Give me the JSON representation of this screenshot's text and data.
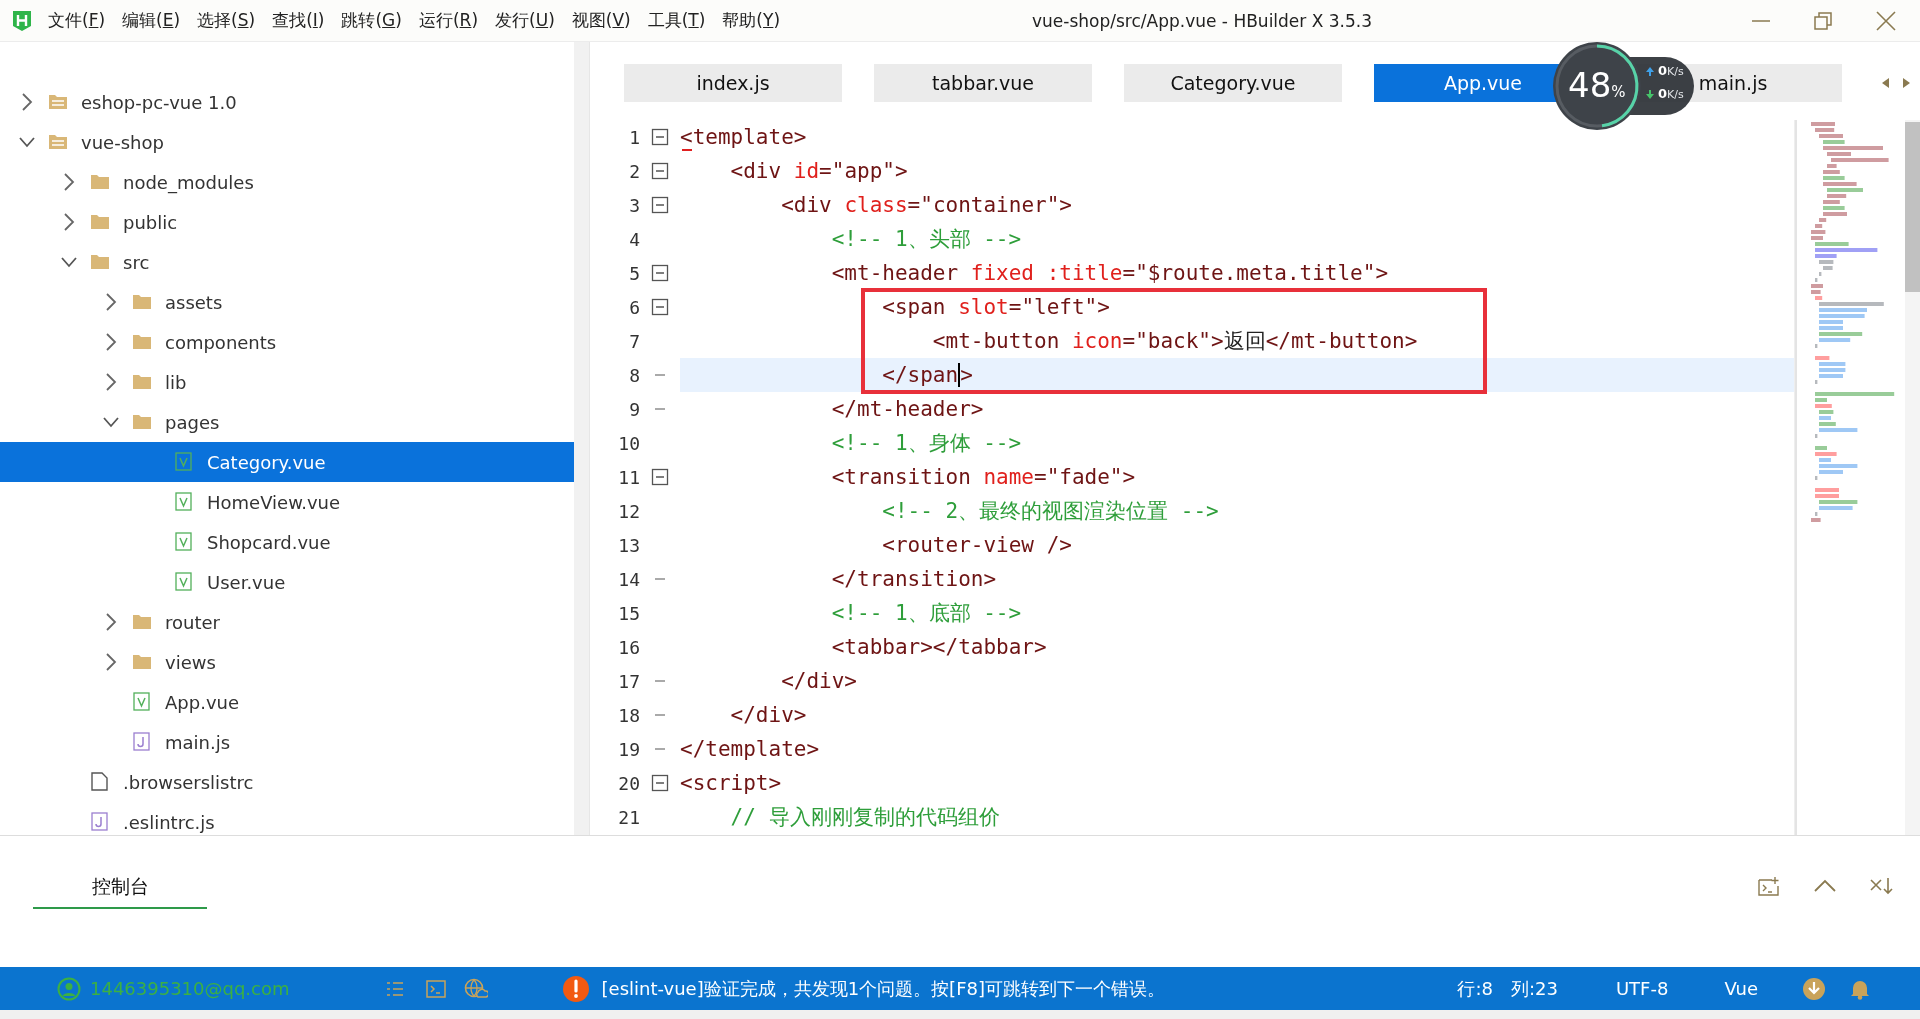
{
  "window": {
    "title": "vue-shop/src/App.vue - HBuilder X 3.5.3"
  },
  "menu": [
    "文件(F)",
    "编辑(E)",
    "选择(S)",
    "查找(I)",
    "跳转(G)",
    "运行(R)",
    "发行(U)",
    "视图(V)",
    "工具(T)",
    "帮助(Y)"
  ],
  "sidebar": {
    "tree": [
      {
        "label": "eshop-pc-vue 1.0",
        "kind": "project",
        "expanded": false,
        "selected": false
      },
      {
        "label": "vue-shop",
        "kind": "project",
        "expanded": true,
        "selected": false,
        "children": [
          {
            "label": "node_modules",
            "kind": "folder",
            "expanded": false,
            "selected": false
          },
          {
            "label": "public",
            "kind": "folder",
            "expanded": false,
            "selected": false
          },
          {
            "label": "src",
            "kind": "folder",
            "expanded": true,
            "selected": false,
            "children": [
              {
                "label": "assets",
                "kind": "folder",
                "expanded": false,
                "selected": false
              },
              {
                "label": "components",
                "kind": "folder",
                "expanded": false,
                "selected": false
              },
              {
                "label": "lib",
                "kind": "folder",
                "expanded": false,
                "selected": false
              },
              {
                "label": "pages",
                "kind": "folder",
                "expanded": true,
                "selected": false,
                "children": [
                  {
                    "label": "Category.vue",
                    "kind": "vue",
                    "selected": true
                  },
                  {
                    "label": "HomeView.vue",
                    "kind": "vue",
                    "selected": false
                  },
                  {
                    "label": "Shopcard.vue",
                    "kind": "vue",
                    "selected": false
                  },
                  {
                    "label": "User.vue",
                    "kind": "vue",
                    "selected": false
                  }
                ]
              },
              {
                "label": "router",
                "kind": "folder",
                "expanded": false,
                "selected": false
              },
              {
                "label": "views",
                "kind": "folder",
                "expanded": false,
                "selected": false
              },
              {
                "label": "App.vue",
                "kind": "vue",
                "selected": false
              },
              {
                "label": "main.js",
                "kind": "js",
                "selected": false
              }
            ]
          },
          {
            "label": ".browserslistrc",
            "kind": "file",
            "selected": false
          },
          {
            "label": ".eslintrc.js",
            "kind": "js",
            "selected": false
          }
        ]
      }
    ]
  },
  "tabs": [
    {
      "label": "index.js",
      "selected": false
    },
    {
      "label": "tabbar.vue",
      "selected": false
    },
    {
      "label": "Category.vue",
      "selected": false
    },
    {
      "label": "App.vue",
      "selected": true
    },
    {
      "label": "main.js",
      "selected": false
    }
  ],
  "editor": {
    "lines": [
      {
        "number": "1",
        "fold_start": true,
        "error": true,
        "segments": [
          {
            "kind": "tag",
            "text": "<template>"
          }
        ]
      },
      {
        "number": "2",
        "fold_start": true,
        "segments": [
          {
            "kind": "tag",
            "text": "    <div "
          },
          {
            "kind": "attr",
            "text": "id"
          },
          {
            "kind": "tag",
            "text": "=\"app\">"
          }
        ]
      },
      {
        "number": "3",
        "fold_start": true,
        "segments": [
          {
            "kind": "tag",
            "text": "        <div "
          },
          {
            "kind": "attr",
            "text": "class"
          },
          {
            "kind": "tag",
            "text": "=\"container\">"
          }
        ]
      },
      {
        "number": "4",
        "segments": [
          {
            "kind": "comment",
            "text": "            <!-- 1、头部 -->"
          }
        ]
      },
      {
        "number": "5",
        "fold_start": true,
        "segments": [
          {
            "kind": "tag",
            "text": "            <mt-header "
          },
          {
            "kind": "attr",
            "text": "fixed :title"
          },
          {
            "kind": "tag",
            "text": "=\"$route.meta.title\">"
          }
        ]
      },
      {
        "number": "6",
        "fold_start": true,
        "framed": true,
        "segments": [
          {
            "kind": "tag",
            "text": "                <span "
          },
          {
            "kind": "attr",
            "text": "slot"
          },
          {
            "kind": "tag",
            "text": "=\"left\">"
          }
        ]
      },
      {
        "number": "7",
        "framed": true,
        "segments": [
          {
            "kind": "tag",
            "text": "                    <mt-button "
          },
          {
            "kind": "attr",
            "text": "icon"
          },
          {
            "kind": "tag",
            "text": "=\"back\">"
          },
          {
            "kind": "text",
            "text": "返回"
          },
          {
            "kind": "tag",
            "text": "</mt-button>"
          }
        ]
      },
      {
        "number": "8",
        "fold_end": true,
        "framed": true,
        "current": true,
        "segments": [
          {
            "kind": "tag",
            "text": "                </span"
          },
          {
            "kind": "tag",
            "text": ">",
            "caret": true
          }
        ]
      },
      {
        "number": "9",
        "fold_end": true,
        "segments": [
          {
            "kind": "tag",
            "text": "            </mt-header>"
          }
        ]
      },
      {
        "number": "10",
        "segments": [
          {
            "kind": "comment",
            "text": "            <!-- 1、身体 -->"
          }
        ]
      },
      {
        "number": "11",
        "fold_start": true,
        "segments": [
          {
            "kind": "tag",
            "text": "            <transition "
          },
          {
            "kind": "attr",
            "text": "name"
          },
          {
            "kind": "tag",
            "text": "=\"fade\">"
          }
        ]
      },
      {
        "number": "12",
        "segments": [
          {
            "kind": "comment",
            "text": "                <!-- 2、最终的视图渲染位置 -->"
          }
        ]
      },
      {
        "number": "13",
        "segments": [
          {
            "kind": "tag",
            "text": "                <router-view />"
          }
        ]
      },
      {
        "number": "14",
        "fold_end": true,
        "segments": [
          {
            "kind": "tag",
            "text": "            </transition>"
          }
        ]
      },
      {
        "number": "15",
        "segments": [
          {
            "kind": "comment",
            "text": "            <!-- 1、底部 -->"
          }
        ]
      },
      {
        "number": "16",
        "segments": [
          {
            "kind": "tag",
            "text": "            <tabbar></tabbar>"
          }
        ]
      },
      {
        "number": "17",
        "fold_end": true,
        "segments": [
          {
            "kind": "tag",
            "text": "        </div>"
          }
        ]
      },
      {
        "number": "18",
        "fold_end": true,
        "segments": [
          {
            "kind": "tag",
            "text": "    </div>"
          }
        ]
      },
      {
        "number": "19",
        "fold_end": true,
        "segments": [
          {
            "kind": "tag",
            "text": "</template>"
          }
        ]
      },
      {
        "number": "20",
        "fold_start": true,
        "segments": [
          {
            "kind": "tag",
            "text": "<script>"
          }
        ]
      },
      {
        "number": "21",
        "segments": [
          {
            "kind": "comment",
            "text": "    // 导入刚刚复制的代码组价"
          }
        ]
      }
    ]
  },
  "net_monitor": {
    "percent": "48",
    "unit": "%",
    "level": 0.48,
    "upload": {
      "value": "0",
      "unit": "K/s"
    },
    "download": {
      "value": "0",
      "unit": "K/s"
    }
  },
  "panel": {
    "tabs": [
      {
        "label": "控制台",
        "selected": true
      }
    ]
  },
  "status_bar": {
    "user": "1446395310@qq.com",
    "message": "[eslint-vue]验证完成，共发现1个问题。按[F8]可跳转到下一个错误。",
    "line": "行:8",
    "column": "列:23",
    "encoding": "UTF-8",
    "language": "Vue"
  }
}
